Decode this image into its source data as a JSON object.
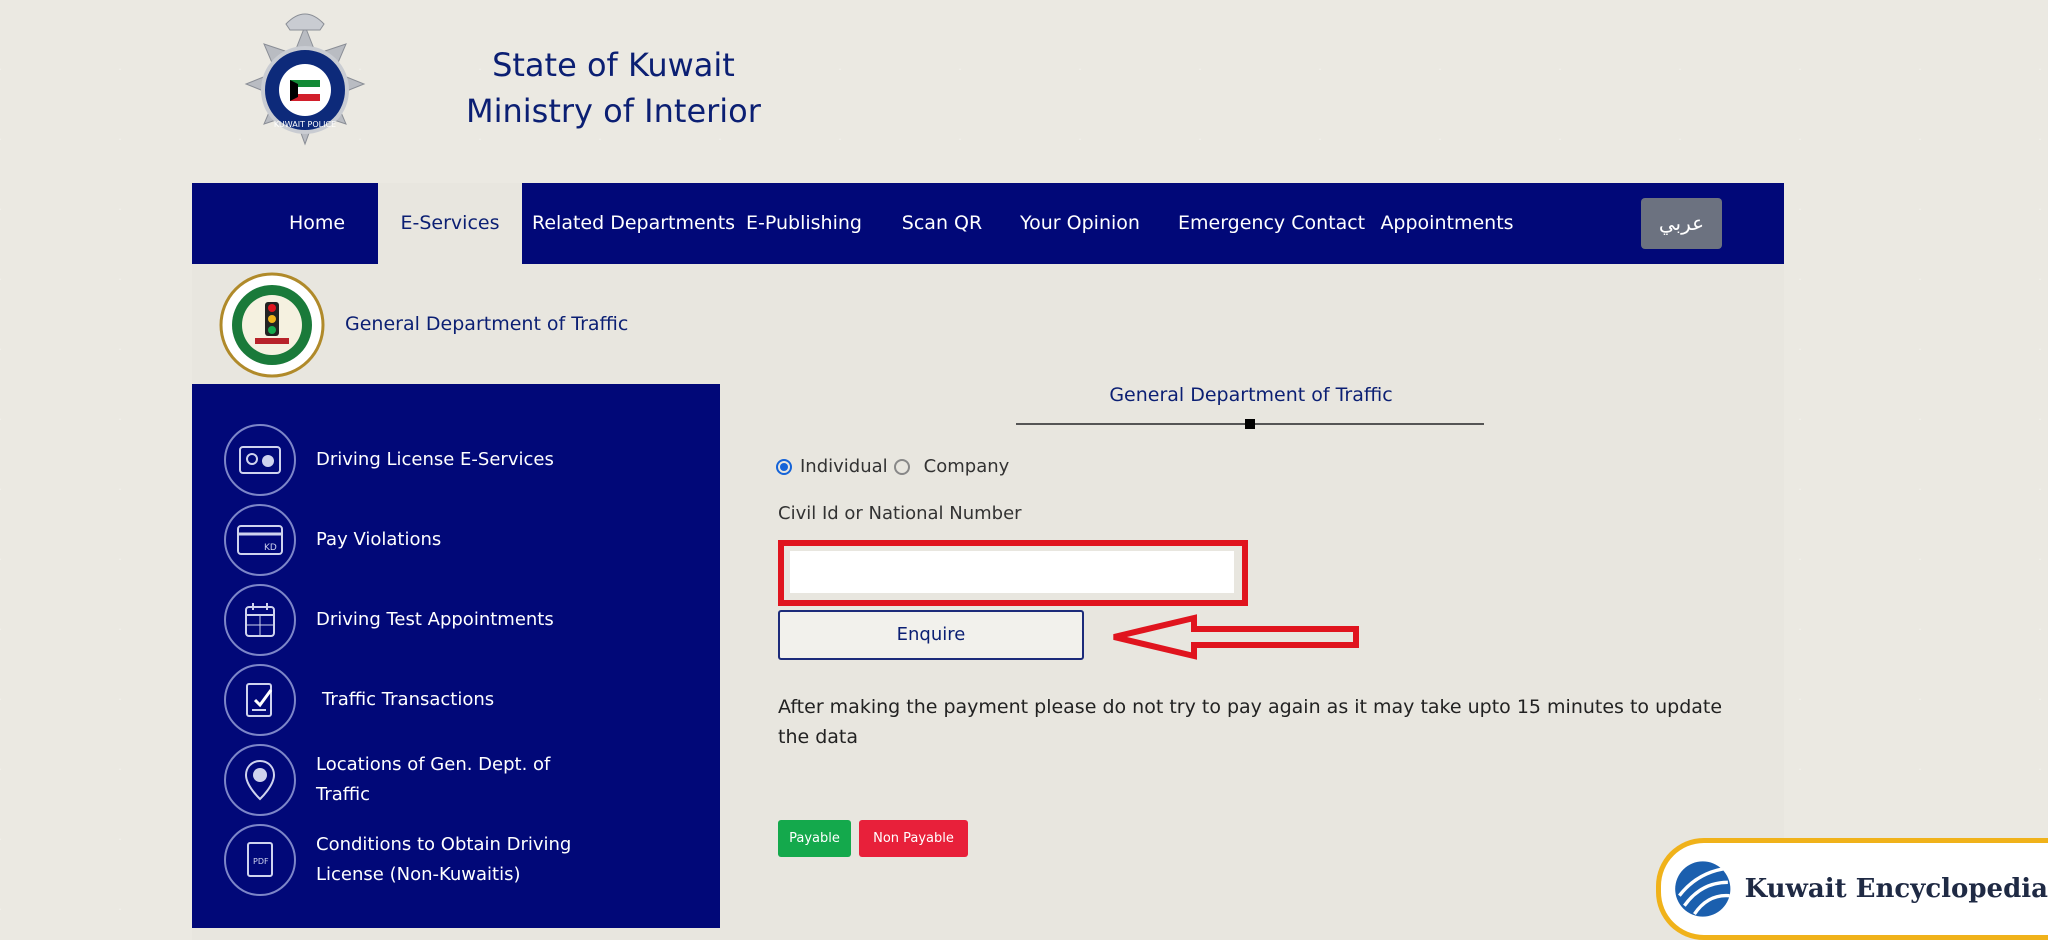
{
  "header": {
    "emblem_text": "KUWAIT POLICE",
    "line1": "State of Kuwait",
    "line2": "Ministry of Interior"
  },
  "nav": {
    "items": [
      "Home",
      "E-Services",
      "Related Departments",
      "E-Publishing",
      "Scan QR",
      "Your Opinion",
      "Emergency Contact",
      "Appointments"
    ],
    "active": "E-Services",
    "lang_button": "عربي"
  },
  "department": {
    "title": "General Department of Traffic"
  },
  "sidebar": {
    "items": [
      {
        "label": "Driving License E-Services",
        "icon": "license-card-icon"
      },
      {
        "label": "Pay Violations",
        "icon": "kd-card-icon"
      },
      {
        "label": "Driving Test Appointments",
        "icon": "calendar-icon"
      },
      {
        "label": "Traffic Transactions",
        "icon": "document-check-icon"
      },
      {
        "label": "Locations of Gen. Dept. of Traffic",
        "icon": "location-pin-icon"
      },
      {
        "label": "Conditions to Obtain Driving License (Non-Kuwaitis)",
        "icon": "pdf-document-icon"
      }
    ]
  },
  "form": {
    "title": "General Department of Traffic",
    "radio_individual": "Individual",
    "radio_company": "Company",
    "selected": "Individual",
    "field_label": "Civil Id or National Number",
    "field_value": "",
    "field_placeholder": "",
    "submit_label": "Enquire",
    "note": "After making the payment please do not try to pay again as it may take upto 15 minutes to update the data",
    "badge_payable": "Payable",
    "badge_non_payable": "Non Payable"
  },
  "watermark": {
    "text": "Kuwait Encyclopedia"
  },
  "colors": {
    "nav_blue": "#010878",
    "title_blue": "#0b1f73",
    "highlight_red": "#e0141e",
    "payable_green": "#14a94c",
    "non_payable_red": "#e8203a",
    "gold": "#f0b21a"
  }
}
